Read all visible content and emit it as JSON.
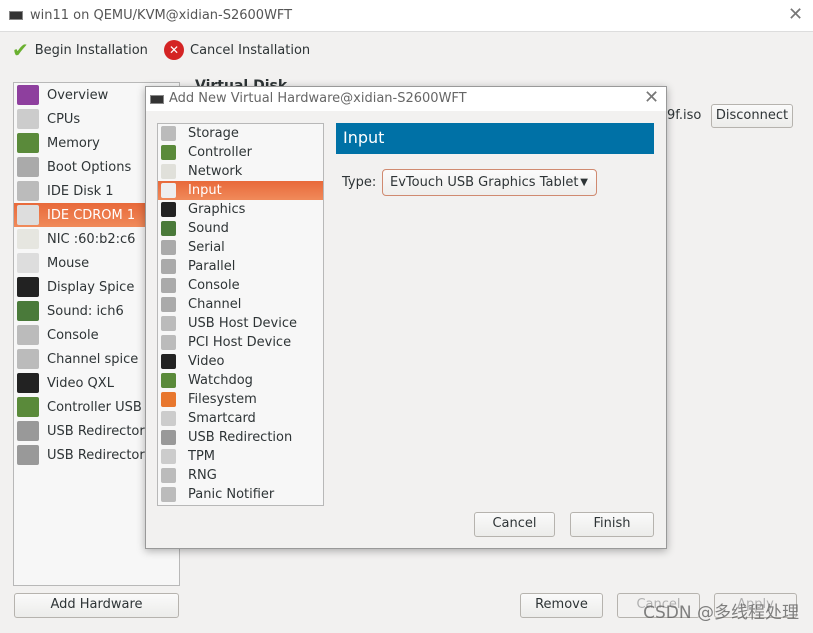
{
  "window": {
    "title": "win11 on QEMU/KVM@xidian-S2600WFT",
    "close": "✕"
  },
  "toolbar": {
    "begin": "Begin Installation",
    "cancel": "Cancel Installation"
  },
  "sidebar": {
    "items": [
      {
        "label": "Overview",
        "icon": "monitor-purple-icon",
        "color": "#8e3f9e"
      },
      {
        "label": "CPUs",
        "icon": "cpu-icon",
        "color": "#cccccc"
      },
      {
        "label": "Memory",
        "icon": "memory-icon",
        "color": "#5a8a3a"
      },
      {
        "label": "Boot Options",
        "icon": "gears-icon",
        "color": "#aaaaaa"
      },
      {
        "label": "IDE Disk 1",
        "icon": "disk-icon",
        "color": "#bbbbbb"
      },
      {
        "label": "IDE CDROM 1",
        "icon": "cdrom-icon",
        "color": "#dddddd"
      },
      {
        "label": "NIC :60:b2:c6",
        "icon": "network-icon",
        "color": "#e6e6e0"
      },
      {
        "label": "Mouse",
        "icon": "mouse-icon",
        "color": "#dddddd"
      },
      {
        "label": "Display Spice",
        "icon": "display-icon",
        "color": "#222222"
      },
      {
        "label": "Sound: ich6",
        "icon": "sound-card-icon",
        "color": "#4a7a3a"
      },
      {
        "label": "Console",
        "icon": "serial-icon",
        "color": "#bbbbbb"
      },
      {
        "label": "Channel spice",
        "icon": "serial-icon",
        "color": "#bbbbbb"
      },
      {
        "label": "Video QXL",
        "icon": "video-icon",
        "color": "#222222"
      },
      {
        "label": "Controller USB",
        "icon": "controller-icon",
        "color": "#5a8a3a"
      },
      {
        "label": "USB Redirector",
        "icon": "usb-icon",
        "color": "#999999"
      },
      {
        "label": "USB Redirector",
        "icon": "usb-icon",
        "color": "#999999"
      }
    ],
    "selected": 5
  },
  "background": {
    "section_title": "Virtual Disk",
    "iso_fragment": "9f.iso",
    "disconnect": "Disconnect"
  },
  "footer": {
    "add_hardware": "Add Hardware",
    "remove": "Remove",
    "cancel": "Cancel",
    "apply": "Apply"
  },
  "dialog": {
    "title": "Add New Virtual Hardware@xidian-S2600WFT",
    "close": "✕",
    "items": [
      {
        "label": "Storage",
        "icon": "disk-icon",
        "color": "#bbbbbb"
      },
      {
        "label": "Controller",
        "icon": "controller-icon",
        "color": "#5a8a3a"
      },
      {
        "label": "Network",
        "icon": "network-icon",
        "color": "#e0e0da"
      },
      {
        "label": "Input",
        "icon": "mouse-icon",
        "color": "#eeeeee"
      },
      {
        "label": "Graphics",
        "icon": "display-icon",
        "color": "#222222"
      },
      {
        "label": "Sound",
        "icon": "sound-card-icon",
        "color": "#4a7a3a"
      },
      {
        "label": "Serial",
        "icon": "serial-icon",
        "color": "#aaaaaa"
      },
      {
        "label": "Parallel",
        "icon": "serial-icon",
        "color": "#aaaaaa"
      },
      {
        "label": "Console",
        "icon": "serial-icon",
        "color": "#aaaaaa"
      },
      {
        "label": "Channel",
        "icon": "serial-icon",
        "color": "#aaaaaa"
      },
      {
        "label": "USB Host Device",
        "icon": "gears-icon",
        "color": "#bbbbbb"
      },
      {
        "label": "PCI Host Device",
        "icon": "gears-icon",
        "color": "#bbbbbb"
      },
      {
        "label": "Video",
        "icon": "video-icon",
        "color": "#222222"
      },
      {
        "label": "Watchdog",
        "icon": "watchdog-icon",
        "color": "#5a8a3a"
      },
      {
        "label": "Filesystem",
        "icon": "folder-icon",
        "color": "#e8772e"
      },
      {
        "label": "Smartcard",
        "icon": "smartcard-icon",
        "color": "#cccccc"
      },
      {
        "label": "USB Redirection",
        "icon": "usb-icon",
        "color": "#999999"
      },
      {
        "label": "TPM",
        "icon": "tpm-icon",
        "color": "#cccccc"
      },
      {
        "label": "RNG",
        "icon": "gears-icon",
        "color": "#bbbbbb"
      },
      {
        "label": "Panic Notifier",
        "icon": "gears-icon",
        "color": "#bbbbbb"
      }
    ],
    "selected": 3,
    "header": "Input",
    "header_color": "#0071a6",
    "type_label": "Type:",
    "type_value": "EvTouch USB Graphics Tablet",
    "cancel": "Cancel",
    "finish": "Finish"
  },
  "watermark": "CSDN @多线程处理"
}
